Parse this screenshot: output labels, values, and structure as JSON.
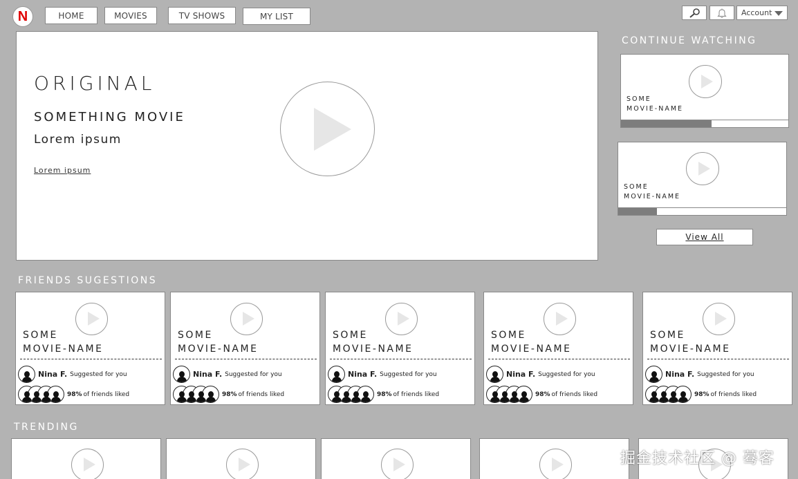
{
  "logo": {
    "letter": "N"
  },
  "nav": {
    "items": [
      {
        "label": "HOME"
      },
      {
        "label": "MOVIES"
      },
      {
        "label": "TV SHOWS"
      },
      {
        "label": "MY LIST"
      }
    ]
  },
  "toolbar": {
    "search_icon": "search-icon",
    "bell_icon": "bell-icon",
    "account_label": "Account"
  },
  "hero": {
    "tag": "ORIGINAL",
    "title": "SOMETHING MOVIE",
    "subtitle": "Lorem ipsum",
    "link": "Lorem ipsum"
  },
  "continue_watching": {
    "heading": "CONTINUE WATCHING",
    "items": [
      {
        "line1": "SOME",
        "line2": "MOVIE-NAME",
        "progress": 0.54
      },
      {
        "line1": "SOME",
        "line2": "MOVIE-NAME",
        "progress": 0.23
      }
    ],
    "view_all": "View All"
  },
  "friends": {
    "heading": "FRIENDS SUGESTIONS",
    "items": [
      {
        "line1": "SOME",
        "line2": "MOVIE-NAME",
        "friend": "Nina F.",
        "note": "Suggested for you",
        "pct": "98%",
        "liked": "of friends liked"
      },
      {
        "line1": "SOME",
        "line2": "MOVIE-NAME",
        "friend": "Nina F.",
        "note": "Suggested for you",
        "pct": "98%",
        "liked": "of friends liked"
      },
      {
        "line1": "SOME",
        "line2": "MOVIE-NAME",
        "friend": "Nina F.",
        "note": "Suggested for you",
        "pct": "98%",
        "liked": "of friends liked"
      },
      {
        "line1": "SOME",
        "line2": "MOVIE-NAME",
        "friend": "Nina F.",
        "note": "Suggested for you",
        "pct": "98%",
        "liked": "of friends liked"
      },
      {
        "line1": "SOME",
        "line2": "MOVIE-NAME",
        "friend": "Nina F.",
        "note": "Suggested for you",
        "pct": "98%",
        "liked": "of friends liked"
      }
    ]
  },
  "trending": {
    "heading": "TRENDING",
    "count": 5
  },
  "watermark": "掘金技术社区 @ 蓦客"
}
